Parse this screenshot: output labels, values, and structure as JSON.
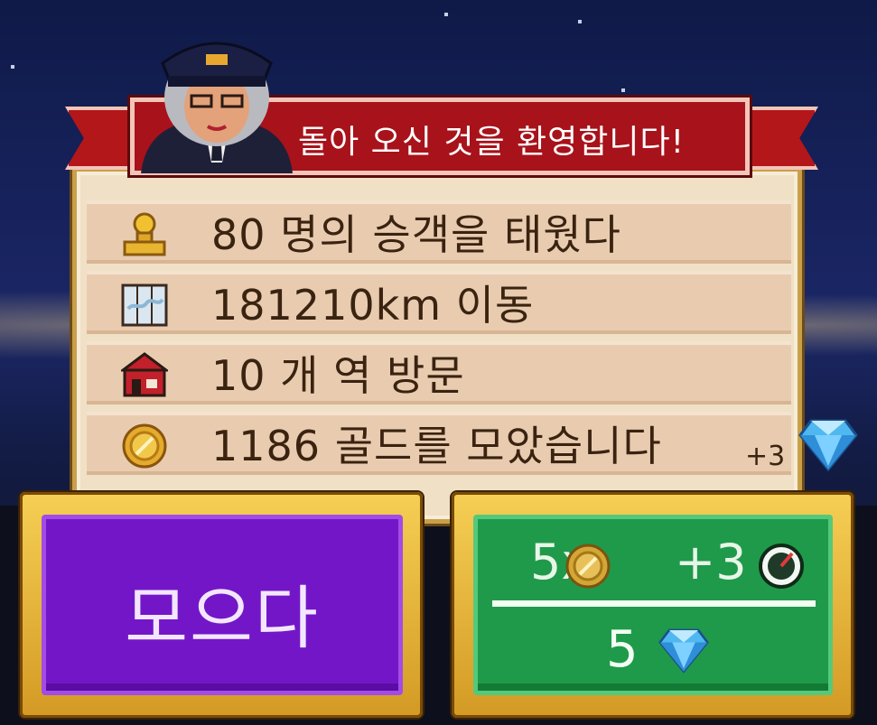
{
  "banner": {
    "title": "돌아 오신 것을 환영합니다!"
  },
  "stats": [
    {
      "icon": "passenger-icon",
      "text": "80 명의 승객을 태웠다"
    },
    {
      "icon": "map-icon",
      "text": "181210km 이동"
    },
    {
      "icon": "station-icon",
      "text": "10 개 역 방문"
    },
    {
      "icon": "gold-coin-icon",
      "text": "1186 골드를 모았습니다"
    }
  ],
  "bonus": {
    "text": "+3",
    "icon": "diamond-icon"
  },
  "collect_button": {
    "label": "모으다"
  },
  "boost_button": {
    "multiplier": "5x",
    "bonus": "+3",
    "cost": "5"
  },
  "colors": {
    "banner": "#a8121a",
    "collect": "#7316c8",
    "boost": "#1f9a4a",
    "gold": "#e0a628"
  }
}
